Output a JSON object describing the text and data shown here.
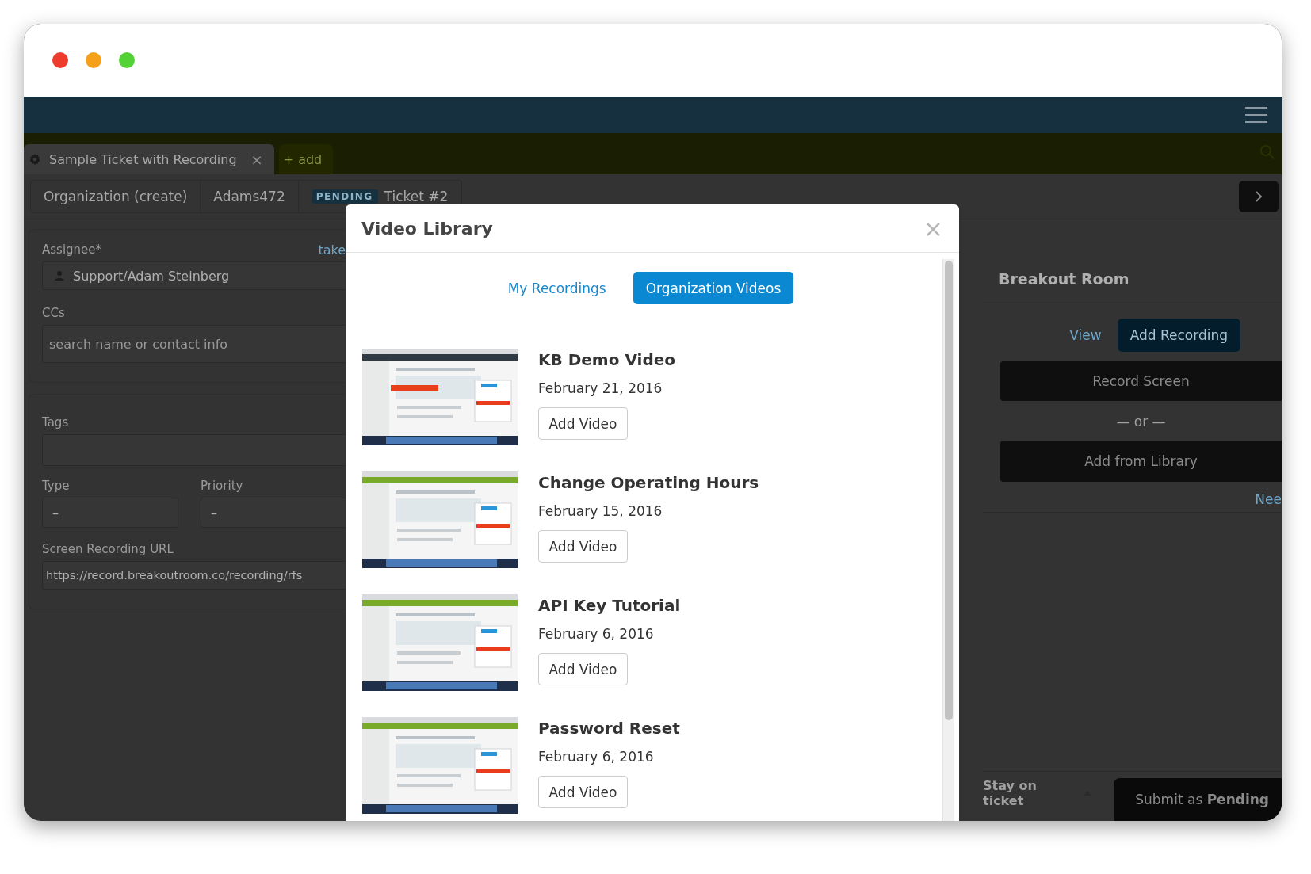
{
  "ticket_tabs": [
    {
      "label": "Sample Ticket with Recording",
      "selected": true,
      "close": "×"
    },
    {
      "label": "+ add",
      "selected": false
    }
  ],
  "sub_tabs": [
    {
      "label": "Organization (create)"
    },
    {
      "label": "Adams472"
    },
    {
      "badge": "PENDING",
      "label": "Ticket #2"
    }
  ],
  "form": {
    "assignee": {
      "label": "Assignee*",
      "link": "take",
      "value": "Support/Adam Steinberg"
    },
    "ccs": {
      "label": "CCs",
      "placeholder": "search name or contact info"
    },
    "tags": {
      "label": "Tags"
    },
    "type": {
      "label": "Type",
      "value": "–"
    },
    "priority": {
      "label": "Priority",
      "value": "–"
    },
    "url": {
      "label": "Screen Recording URL",
      "value": "https://record.breakoutroom.co/recording/rfs"
    }
  },
  "breakout": {
    "title": "Breakout Room",
    "view_link": "View",
    "add_recording": "Add Recording",
    "record_screen": "Record Screen",
    "separator": "— or —",
    "add_from_library": "Add from Library",
    "help_link": "Nee"
  },
  "footer": {
    "stay": "Stay on ticket",
    "submit": "Submit as **Pending**"
  },
  "modal": {
    "title": "Video Library",
    "close": "×",
    "tabs": [
      {
        "label": "My Recordings",
        "selected": false
      },
      {
        "label": "Organization Videos",
        "selected": true
      }
    ],
    "videos": [
      {
        "title": "KB Demo Video",
        "date": "February 21, 2016",
        "button": "Add Video"
      },
      {
        "title": "Change Operating Hours",
        "date": "February 15, 2016",
        "button": "Add Video"
      },
      {
        "title": "API Key Tutorial",
        "date": "February 6, 2016",
        "button": "Add Video"
      },
      {
        "title": "Password Reset",
        "date": "February 6, 2016",
        "button": "Add Video"
      }
    ]
  }
}
